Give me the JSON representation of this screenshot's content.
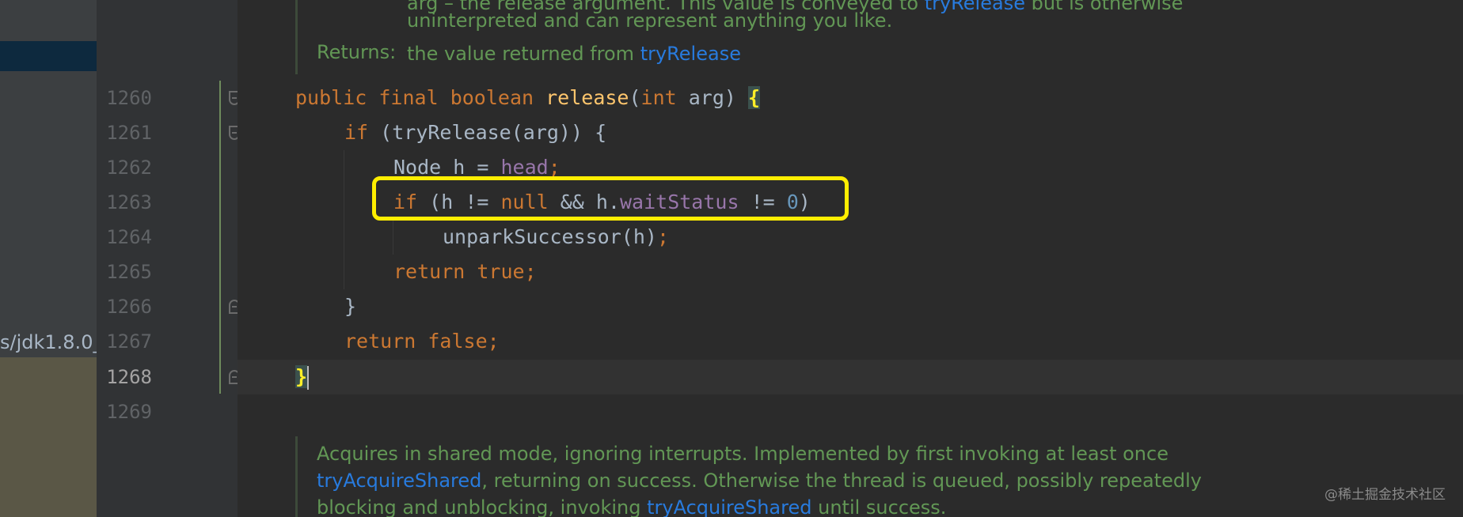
{
  "sidebar": {
    "path_text": "s/jdk1.8.0_"
  },
  "doc_top": {
    "line1_prefix": "arg – the release argument. This value is conveyed to ",
    "line1_link": "tryRelease",
    "line1_suffix": " but is otherwise",
    "line2": "uninterpreted and can represent anything you like.",
    "returns_label": "Returns:",
    "returns_text": "the value returned from ",
    "returns_link": "tryRelease"
  },
  "line_numbers": [
    "1260",
    "1261",
    "1262",
    "1263",
    "1264",
    "1265",
    "1266",
    "1267",
    "1268",
    "1269"
  ],
  "code": {
    "l1260": {
      "public": "public",
      "final": "final",
      "boolean": "boolean",
      "method": "release",
      "open_paren": "(",
      "int": "int",
      "param": " arg) ",
      "brace": "{"
    },
    "l1261": {
      "if": "if",
      "rest": " (tryRelease(arg)) {"
    },
    "l1262": {
      "type": "Node h = ",
      "field": "head",
      "semi": ";"
    },
    "l1263": {
      "if": "if",
      "part1": " (h != ",
      "null": "null",
      "part2": " && h.",
      "field": "waitStatus",
      "part3": " != ",
      "zero": "0",
      "part4": ")"
    },
    "l1264": {
      "call": "unparkSuccessor(h)",
      "semi": ";"
    },
    "l1265": {
      "return": "return",
      "value": "true",
      "semi": ";"
    },
    "l1266": {
      "brace": "}"
    },
    "l1267": {
      "return": "return",
      "value": "false",
      "semi": ";"
    },
    "l1268": {
      "brace": "}"
    }
  },
  "doc_bottom": {
    "line1": "Acquires in shared mode, ignoring interrupts. Implemented by first invoking at least once",
    "line2_link": "tryAcquireShared",
    "line2_suffix": ", returning on success. Otherwise the thread is queued, possibly repeatedly",
    "line3_prefix": "blocking and unblocking, invoking ",
    "line3_link": "tryAcquireShared",
    "line3_suffix": " until success."
  },
  "watermark": "@稀土掘金技术社区",
  "colors": {
    "highlight_box": "#ffee00",
    "keyword": "#cc7832",
    "method": "#ffc66d",
    "field": "#9876aa",
    "number": "#6897bb",
    "doc_text": "#629755",
    "doc_link": "#287bde"
  }
}
